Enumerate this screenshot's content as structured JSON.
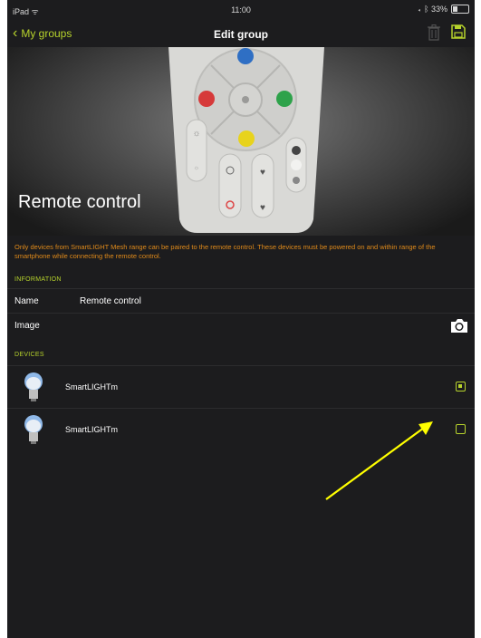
{
  "status_bar": {
    "carrier": "iPad ᯤ",
    "time": "11:00",
    "battery": "◂ ᛒ 33%"
  },
  "nav": {
    "back_label": "My groups",
    "title": "Edit group"
  },
  "hero": {
    "title": "Remote control"
  },
  "notice": "Only devices from SmartLIGHT Mesh range can be paired to the remote control. These devices must be powered on and within range of the smartphone while connecting the remote control.",
  "information": {
    "section_label": "INFORMATION",
    "name_label": "Name",
    "name_value": "Remote control",
    "image_label": "Image"
  },
  "devices": {
    "section_label": "DEVICES",
    "items": [
      {
        "name": "SmartLIGHTm",
        "checked": true
      },
      {
        "name": "SmartLIGHTm",
        "checked": false
      }
    ]
  },
  "colors": {
    "accent": "#b7d32c",
    "notice": "#e08a1a",
    "background": "#1c1c1e",
    "annotation_arrow": "#ffff00"
  }
}
